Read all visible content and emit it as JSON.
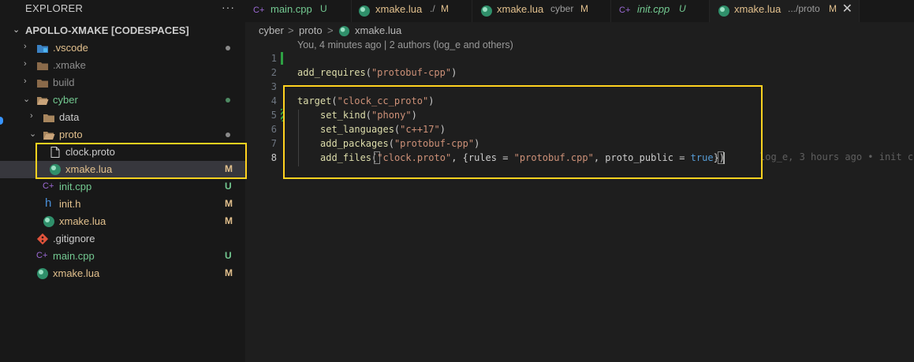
{
  "explorer": {
    "title": "EXPLORER",
    "more": "···",
    "root_label": "APOLLO-XMAKE [CODESPACES]",
    "items": [
      {
        "label": ".vscode",
        "kind": "folder",
        "color": "#e2c08d"
      },
      {
        "label": ".xmake",
        "kind": "folder",
        "color": "#8c8c8c"
      },
      {
        "label": "build",
        "kind": "folder",
        "color": "#8c8c8c"
      },
      {
        "label": "cyber",
        "kind": "folder-open",
        "color": "#73c991"
      },
      {
        "label": "data",
        "kind": "folder",
        "color": "#cccccc"
      },
      {
        "label": "proto",
        "kind": "folder-open",
        "color": "#e2c08d"
      },
      {
        "label": "clock.proto",
        "kind": "file",
        "color": "#cccccc"
      },
      {
        "label": "xmake.lua",
        "kind": "lua",
        "color": "#e2c08d",
        "badge": "M"
      },
      {
        "label": "init.cpp",
        "kind": "cpp",
        "color": "#73c991",
        "badge": "U"
      },
      {
        "label": "init.h",
        "kind": "header",
        "color": "#e2c08d",
        "badge": "M"
      },
      {
        "label": "xmake.lua",
        "kind": "lua",
        "color": "#e2c08d",
        "badge": "M"
      },
      {
        "label": ".gitignore",
        "kind": "git",
        "color": "#cccccc"
      },
      {
        "label": "main.cpp",
        "kind": "cpp",
        "color": "#73c991",
        "badge": "U"
      },
      {
        "label": "xmake.lua",
        "kind": "lua",
        "color": "#e2c08d",
        "badge": "M"
      }
    ]
  },
  "tabs": [
    {
      "name": "main.cpp",
      "desc": "",
      "status": "U",
      "color": "#73c991",
      "italic": false
    },
    {
      "name": "xmake.lua",
      "desc": "./",
      "status": "M",
      "color": "#e2c08d",
      "italic": false
    },
    {
      "name": "xmake.lua",
      "desc": "cyber",
      "status": "M",
      "color": "#e2c08d",
      "italic": false
    },
    {
      "name": "init.cpp",
      "desc": "",
      "status": "U",
      "color": "#73c991",
      "italic": true
    },
    {
      "name": "xmake.lua",
      "desc": ".../proto",
      "status": "M",
      "color": "#e2c08d",
      "italic": false,
      "active": true,
      "close": "✕"
    }
  ],
  "breadcrumbs": [
    "cyber",
    ">",
    "proto",
    ">",
    "xmake.lua"
  ],
  "blame_header": "You, 4 minutes ago | 2 authors (log_e and others)",
  "line_numbers": [
    "1",
    "2",
    "3",
    "4",
    "5",
    "6",
    "7",
    "8"
  ],
  "code": {
    "l2": {
      "fn": "add_requires",
      "open": "(",
      "str": "\"protobuf-cpp\"",
      "close": ")"
    },
    "l4": {
      "fn": "target",
      "open": "(",
      "str": "\"clock_cc_proto\"",
      "close": ")"
    },
    "l5": {
      "fn": "set_kind",
      "open": "(",
      "str": "\"phony\"",
      "close": ")"
    },
    "l6": {
      "fn": "set_languages",
      "open": "(",
      "str": "\"c++17\"",
      "close": ")"
    },
    "l7": {
      "fn": "add_packages",
      "open": "(",
      "str": "\"protobuf-cpp\"",
      "close": ")"
    },
    "l8": {
      "fn": "add_files",
      "open": "(",
      "str1": "\"clock.proto\"",
      "mid1": ", {rules = ",
      "str2": "\"protobuf.cpp\"",
      "mid2": ", proto_public = ",
      "kw": "true",
      "close": "})"
    }
  },
  "inline_blame": "log_e, 3 hours ago • init c",
  "colors": {
    "highlight_box": "#ffd21f",
    "modified": "#e2c08d",
    "untracked": "#73c991",
    "function": "#dcdcaa",
    "string": "#ce9178",
    "keyword": "#569cd6"
  }
}
